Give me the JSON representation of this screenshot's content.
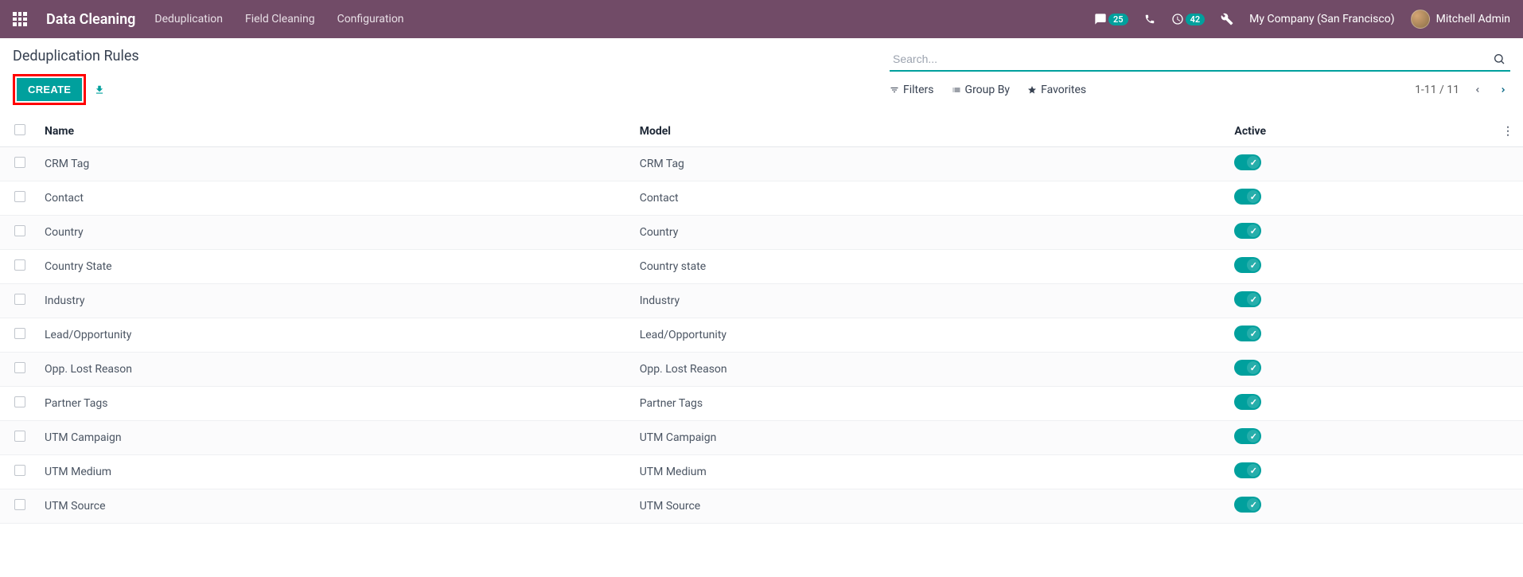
{
  "topbar": {
    "brand": "Data Cleaning",
    "nav": [
      "Deduplication",
      "Field Cleaning",
      "Configuration"
    ],
    "messages_badge": "25",
    "activities_badge": "42",
    "company": "My Company (San Francisco)",
    "user": "Mitchell Admin"
  },
  "breadcrumb": "Deduplication Rules",
  "buttons": {
    "create": "CREATE"
  },
  "search": {
    "placeholder": "Search..."
  },
  "filters": {
    "filters": "Filters",
    "groupby": "Group By",
    "favorites": "Favorites"
  },
  "pager": {
    "range": "1-11 / 11"
  },
  "columns": {
    "name": "Name",
    "model": "Model",
    "active": "Active"
  },
  "rows": [
    {
      "name": "CRM Tag",
      "model": "CRM Tag",
      "active": true
    },
    {
      "name": "Contact",
      "model": "Contact",
      "active": true
    },
    {
      "name": "Country",
      "model": "Country",
      "active": true
    },
    {
      "name": "Country State",
      "model": "Country state",
      "active": true
    },
    {
      "name": "Industry",
      "model": "Industry",
      "active": true
    },
    {
      "name": "Lead/Opportunity",
      "model": "Lead/Opportunity",
      "active": true
    },
    {
      "name": "Opp. Lost Reason",
      "model": "Opp. Lost Reason",
      "active": true
    },
    {
      "name": "Partner Tags",
      "model": "Partner Tags",
      "active": true
    },
    {
      "name": "UTM Campaign",
      "model": "UTM Campaign",
      "active": true
    },
    {
      "name": "UTM Medium",
      "model": "UTM Medium",
      "active": true
    },
    {
      "name": "UTM Source",
      "model": "UTM Source",
      "active": true
    }
  ]
}
